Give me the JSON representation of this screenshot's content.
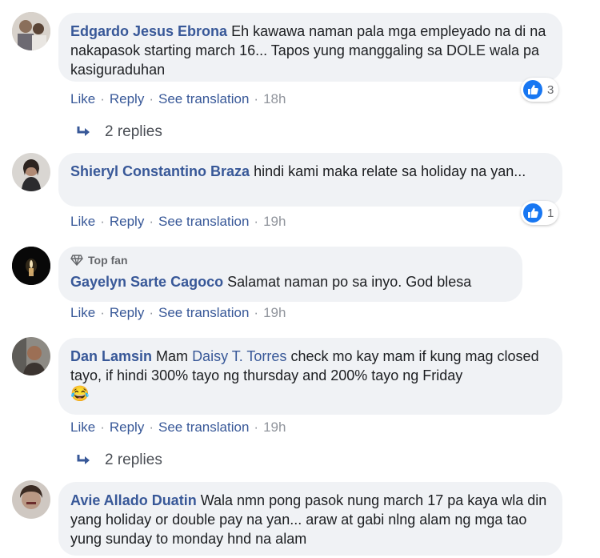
{
  "comments": [
    {
      "author": "Edgardo Jesus Ebrona",
      "text": "Eh kawawa naman pala mga empleyado na di na nakapasok starting march 16... Tapos yung manggaling sa DOLE wala pa kasiguraduhan",
      "like": "Like",
      "reply": "Reply",
      "translate": "See translation",
      "time": "18h",
      "reactions": "3",
      "replies": "2 replies"
    },
    {
      "author": "Shieryl Constantino Braza",
      "text": "hindi kami maka relate sa holiday na yan...",
      "like": "Like",
      "reply": "Reply",
      "translate": "See translation",
      "time": "19h",
      "reactions": "1"
    },
    {
      "badge": "Top fan",
      "author": "Gayelyn Sarte Cagoco",
      "text": "Salamat naman po sa inyo. God blesa",
      "like": "Like",
      "reply": "Reply",
      "translate": "See translation",
      "time": "19h"
    },
    {
      "author": "Dan Lamsin",
      "text_before": "Mam",
      "mention": "Daisy T. Torres",
      "text_after": "check mo kay mam if kung mag closed tayo, if hindi 300% tayo ng thursday and 200% tayo ng Friday",
      "emoji": "😂",
      "like": "Like",
      "reply": "Reply",
      "translate": "See translation",
      "time": "19h",
      "replies": "2 replies"
    },
    {
      "author": "Avie Allado Duatin",
      "text": "Wala nmn pong pasok nung march 17 pa kaya wla din yang holiday or double pay na yan... araw at gabi nlng alam ng mga tao yung sunday to monday hnd na alam"
    }
  ],
  "colors": {
    "link": "#385898",
    "bubble": "#f0f2f5",
    "muted": "#90949c",
    "like_blue": "#1877f2"
  }
}
